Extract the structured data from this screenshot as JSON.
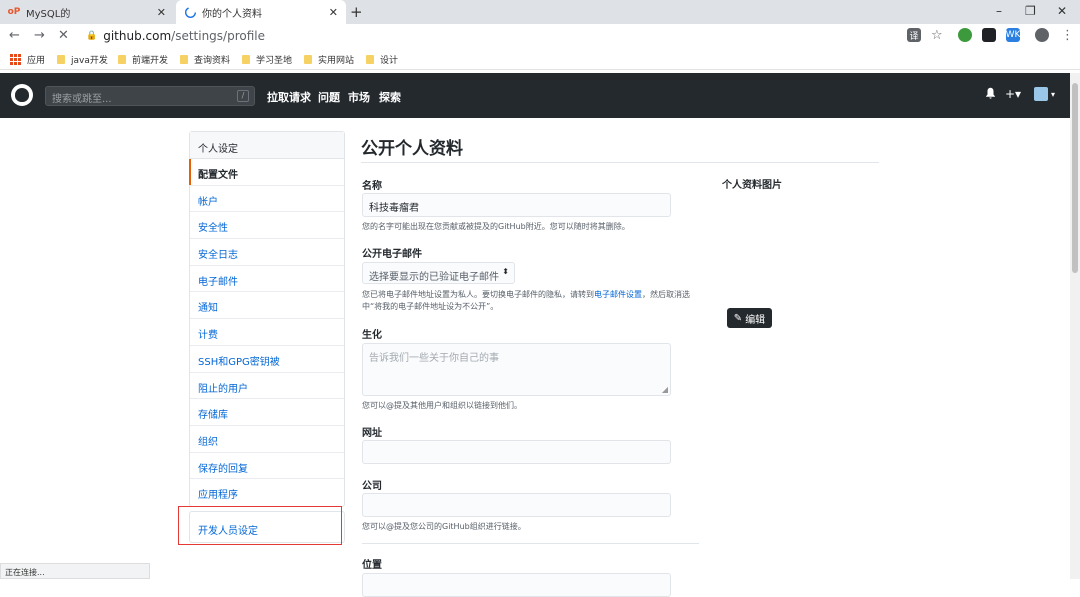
{
  "browser": {
    "tabs": [
      {
        "title": "MySQL的",
        "close": "✕",
        "favicon": "oracle-icon"
      },
      {
        "title": "你的个人资料",
        "close": "✕",
        "favicon": "github-icon"
      }
    ],
    "new_tab": "+",
    "window_controls": {
      "minimize": "–",
      "restore": "❐",
      "close": "✕"
    },
    "url_host": "github.com",
    "url_path": "/settings/profile",
    "bookmarks": [
      {
        "label": "应用"
      },
      {
        "label": "java开发"
      },
      {
        "label": "前端开发"
      },
      {
        "label": "查询资料"
      },
      {
        "label": "学习圣地"
      },
      {
        "label": "实用网站"
      },
      {
        "label": "设计"
      }
    ]
  },
  "github": {
    "search_placeholder": "搜索或跳至...",
    "search_key": "/",
    "nav": [
      "拉取请求",
      "问题",
      "市场",
      "探索"
    ],
    "plus": "+▾",
    "avatar_caret": "▾"
  },
  "sidebar": {
    "heading": "个人设定",
    "items": [
      {
        "label": "配置文件",
        "selected": true
      },
      {
        "label": "帐户"
      },
      {
        "label": "安全性"
      },
      {
        "label": "安全日志"
      },
      {
        "label": "电子邮件"
      },
      {
        "label": "通知"
      },
      {
        "label": "计费"
      },
      {
        "label": "SSH和GPG密钥被"
      },
      {
        "label": "阻止的用户"
      },
      {
        "label": "存储库"
      },
      {
        "label": "组织"
      },
      {
        "label": "保存的回复"
      },
      {
        "label": "应用程序"
      }
    ],
    "developer_settings": "开发人员设定"
  },
  "profile": {
    "title": "公开个人资料",
    "name_label": "名称",
    "name_value": "科技毒瘤君",
    "name_note": "您的名字可能出现在您贡献或被提及的GitHub附近。您可以随时将其删除。",
    "email_label": "公开电子邮件",
    "email_select": "选择要显示的已验证电子邮件",
    "email_note_1": "您已将电子邮件地址设置为私人。要切换电子邮件的隐私，请转到",
    "email_note_link": "电子邮件设置",
    "email_note_2": "，然后取消选中“将我的电子邮件地址设为不公开”。",
    "bio_label": "生化",
    "bio_placeholder": "告诉我们一些关于你自己的事",
    "bio_note": "您可以@提及其他用户和组织以链接到他们。",
    "url_label": "网址",
    "company_label": "公司",
    "company_note": "您可以@提及您公司的GitHub组织进行链接。",
    "location_label": "位置",
    "picture_label": "个人资料图片",
    "edit_button": "编辑"
  },
  "status_bar": "正在连接..."
}
